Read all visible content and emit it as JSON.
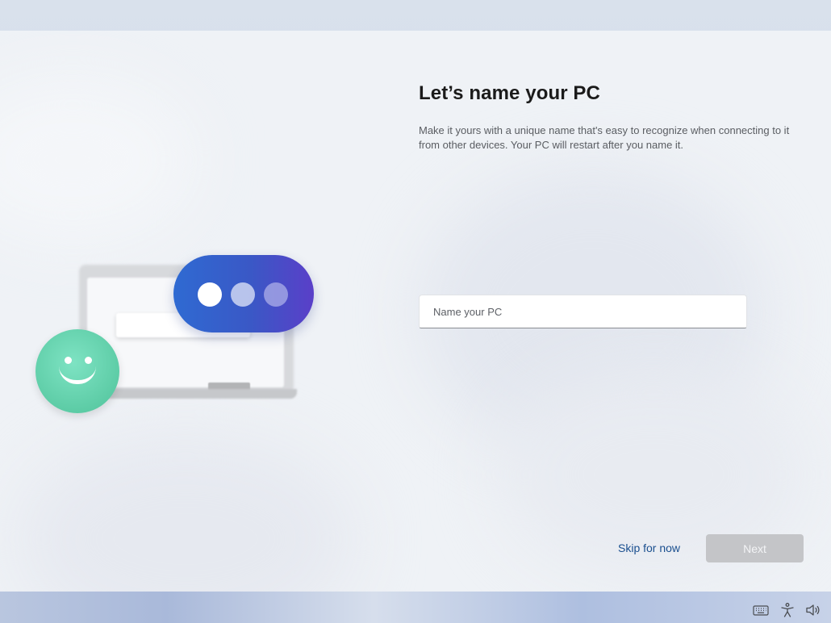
{
  "dialog": {
    "title": "Let’s name your PC",
    "description": "Make it yours with a unique name that's easy to recognize when connecting to it from other devices. Your PC will restart after you name it.",
    "name_input": {
      "placeholder": "Name your PC",
      "value": ""
    },
    "skip_label": "Skip for now",
    "next_label": "Next"
  },
  "illustration": {
    "icons": [
      "laptop-icon",
      "chat-bubble-icon",
      "smiley-icon"
    ]
  },
  "tray": {
    "icons": [
      "keyboard-icon",
      "accessibility-icon",
      "volume-icon"
    ]
  },
  "colors": {
    "accent": "#3a58c6",
    "link": "#1a4f8f",
    "disabled_button": "#c4c5c8",
    "smiley": "#5dcca6"
  }
}
